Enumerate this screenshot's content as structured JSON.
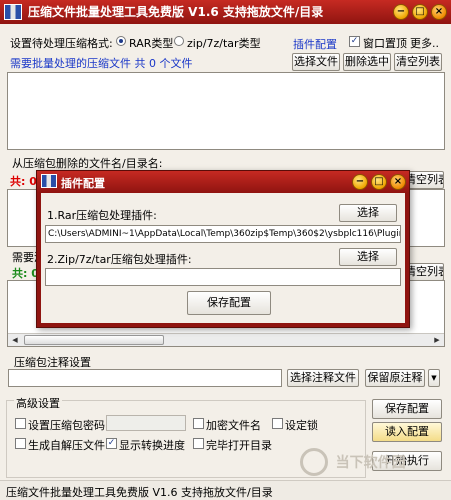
{
  "window": {
    "title": "压缩文件批量处理工具免费版 V1.6   支持拖放文件/目录",
    "min_label": "−",
    "max_label": "□",
    "close_label": "×"
  },
  "format": {
    "label": "设置待处理压缩格式:",
    "rar": "RAR类型",
    "zip": "zip/7z/tar类型",
    "plugin_link": "插件配置",
    "ontop": "窗口置顶",
    "more": "更多.."
  },
  "files": {
    "status": "需要批量处理的压缩文件 共 0 个文件",
    "select_btn": "选择文件",
    "remove_btn": "删除选中",
    "clear_btn": "清空列表"
  },
  "delete_section": {
    "title": "从压缩包删除的文件名/目录名:",
    "status_prefix": "共: 0",
    "clear_btn": "清空列表"
  },
  "add_section": {
    "title": "需要添",
    "status_prefix": "共: 0",
    "clear_btn": "清空列表"
  },
  "comment": {
    "title": "压缩包注释设置",
    "value": "",
    "select_btn": "选择注释文件",
    "keep_btn": "保留原注释"
  },
  "advanced": {
    "title": "高级设置",
    "set_password": "设置压缩包密码",
    "encrypt_names": "加密文件名",
    "set_lock": "设定锁",
    "gen_sfx": "生成自解压文件",
    "show_progress": "显示转换进度",
    "open_dir": "完毕打开目录",
    "save_btn": "保存配置",
    "load_btn": "读入配置",
    "start_btn": "开始执行"
  },
  "statusbar": {
    "text": "压缩文件批量处理工具免费版 V1.6   支持拖放文件/目录"
  },
  "dialog": {
    "title": "插件配置",
    "rar_label": "1.Rar压缩包处理插件:",
    "rar_btn": "选择",
    "rar_path": "C:\\Users\\ADMINI~1\\AppData\\Local\\Temp\\360zip$Temp\\360$2\\ysbplc116\\Plugin",
    "zip_label": "2.Zip/7z/tar压缩包处理插件:",
    "zip_btn": "选择",
    "zip_path": "",
    "save_btn": "保存配置"
  },
  "watermark": "当下软件园",
  "colors": {
    "titlebar": "#b0211a",
    "accent_blue": "#1a37c8",
    "status_red": "#dd0000",
    "status_green": "#1a8a1a"
  },
  "icons": [
    "app-icon",
    "minimize-icon",
    "maximize-icon",
    "close-icon",
    "radio-icon",
    "checkbox-icon"
  ]
}
